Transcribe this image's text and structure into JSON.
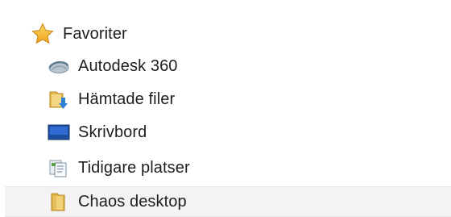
{
  "navigation_pane": {
    "favorites": {
      "label": "Favoriter",
      "icon": "star-icon",
      "items": [
        {
          "label": "Autodesk 360",
          "icon": "autodesk-360-cloud-icon"
        },
        {
          "label": "Hämtade filer",
          "icon": "downloads-folder-icon"
        },
        {
          "label": "Skrivbord",
          "icon": "desktop-icon"
        },
        {
          "label": "Tidigare platser",
          "icon": "recent-places-icon"
        },
        {
          "label": "Chaos desktop",
          "icon": "folder-icon",
          "selected": true
        }
      ]
    }
  },
  "colors": {
    "star": "#f5b428",
    "folder": "#e8c462",
    "selection_background": "#f3f3f3"
  }
}
